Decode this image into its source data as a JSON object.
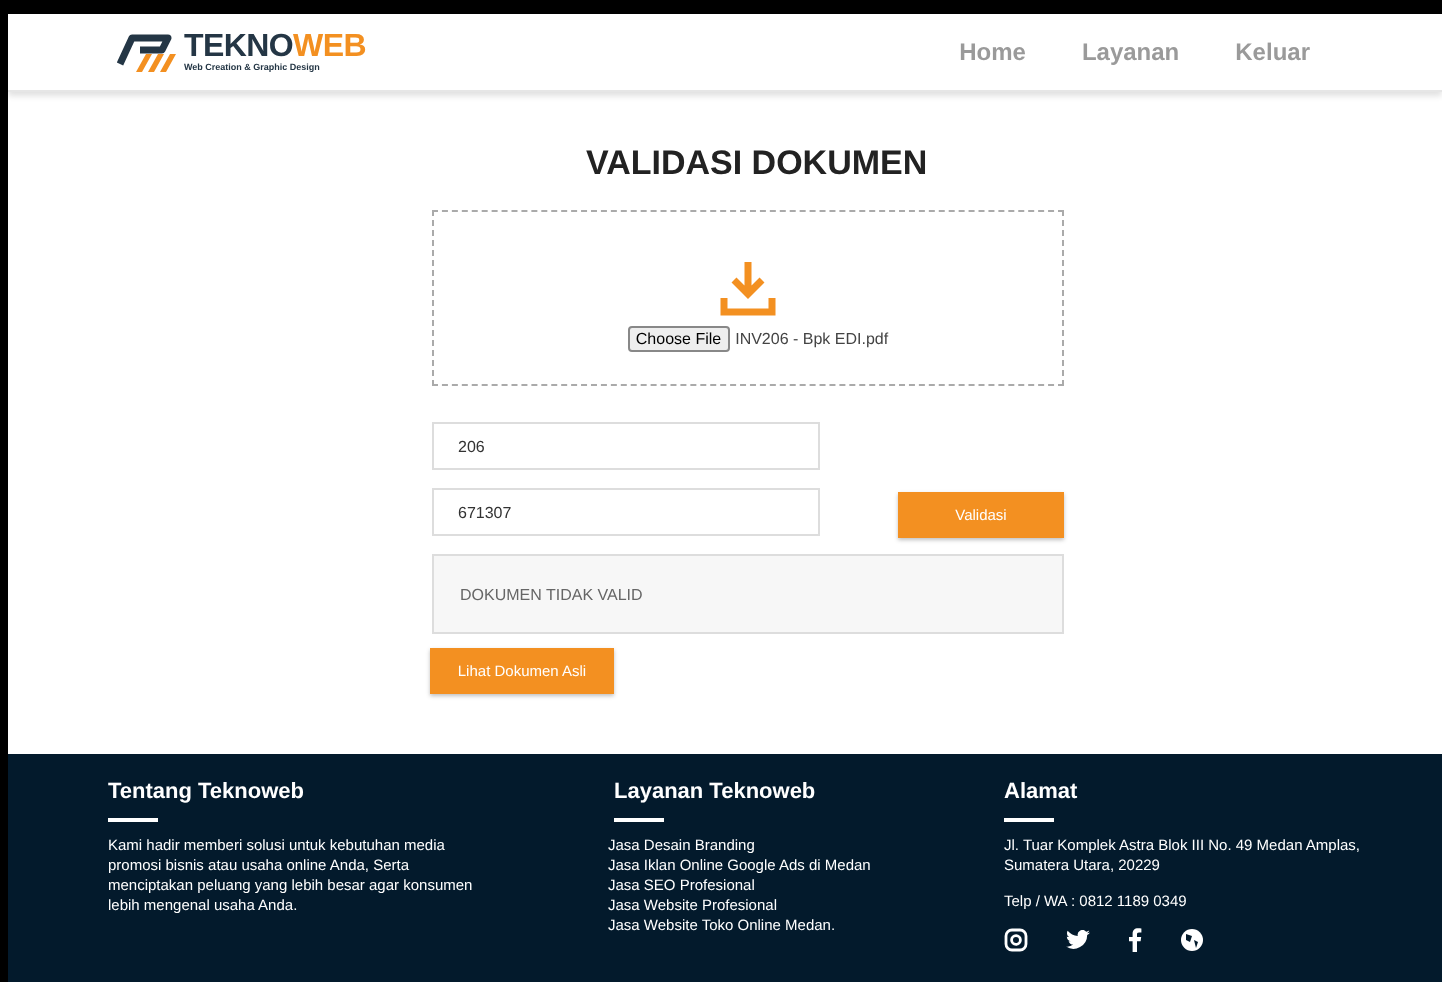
{
  "brand": {
    "name_part1": "TEKNO",
    "name_part2": "WEB",
    "tagline": "Web Creation & Graphic Design"
  },
  "nav": [
    {
      "label": "Home"
    },
    {
      "label": "Layanan"
    },
    {
      "label": "Keluar"
    }
  ],
  "title": "VALIDASI DOKUMEN",
  "upload": {
    "button": "Choose File",
    "file_name": "INV206 - Bpk EDI.pdf"
  },
  "fields": [
    {
      "value": "206"
    },
    {
      "value": "671307"
    }
  ],
  "validate_button": "Validasi",
  "result": "DOKUMEN TIDAK VALID",
  "original_button": "Lihat Dokumen Asli",
  "footer": {
    "about": {
      "heading": "Tentang Teknoweb",
      "text": "Kami hadir memberi solusi untuk kebutuhan media promosi bisnis atau usaha online Anda, Serta menciptakan peluang yang lebih besar agar konsumen lebih mengenal usaha Anda."
    },
    "services": {
      "heading": "Layanan Teknoweb",
      "items": [
        "Jasa Desain Branding",
        "Jasa Iklan Online Google Ads di Medan",
        "Jasa SEO Profesional",
        "Jasa Website Profesional",
        "Jasa Website Toko Online Medan."
      ]
    },
    "address": {
      "heading": "Alamat",
      "lines": [
        "Jl. Tuar Komplek Astra Blok III No. 49 Medan Amplas,",
        "Sumatera Utara, 20229"
      ],
      "phone": "Telp / WA : 0812 1189 0349",
      "social": [
        {
          "kind": "instagram"
        },
        {
          "kind": "twitter"
        },
        {
          "kind": "facebook"
        },
        {
          "kind": "web"
        }
      ]
    }
  }
}
